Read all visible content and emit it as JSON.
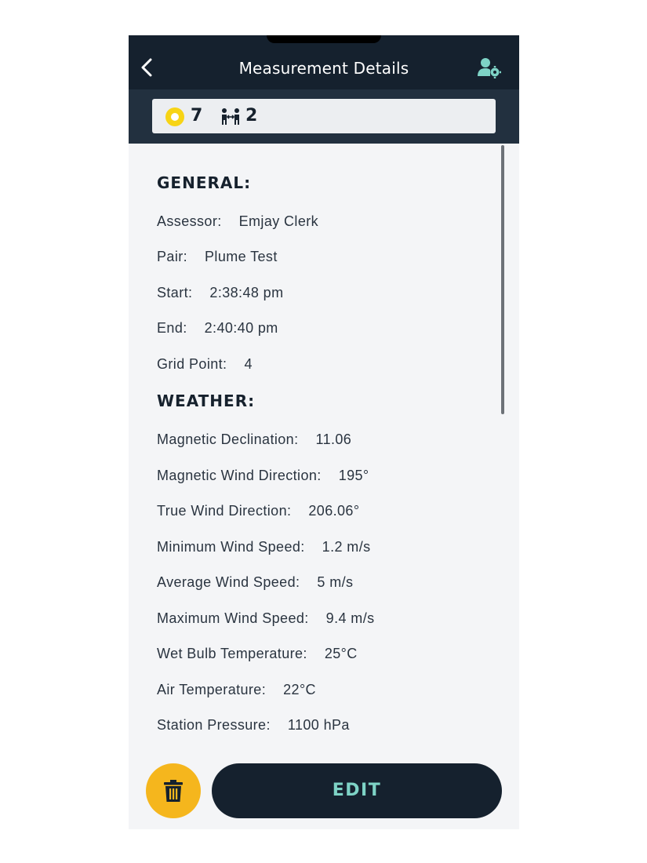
{
  "header": {
    "title": "Measurement Details",
    "back_icon": "chevron-left-icon",
    "settings_icon": "user-settings-icon"
  },
  "summary": {
    "points_icon": "yellow-ring-icon",
    "points_count": "7",
    "pairs_icon": "pair-people-icon",
    "pairs_count": "2"
  },
  "general": {
    "title": "GENERAL:",
    "rows": [
      {
        "label": "Assessor:",
        "value": "Emjay Clerk"
      },
      {
        "label": "Pair:",
        "value": "Plume Test"
      },
      {
        "label": "Start:",
        "value": "2:38:48 pm"
      },
      {
        "label": "End:",
        "value": "2:40:40 pm"
      },
      {
        "label": "Grid Point:",
        "value": "4"
      }
    ]
  },
  "weather": {
    "title": "WEATHER:",
    "rows": [
      {
        "label": "Magnetic Declination:",
        "value": "11.06"
      },
      {
        "label": "Magnetic Wind Direction:",
        "value": "195°"
      },
      {
        "label": "True Wind Direction:",
        "value": "206.06°"
      },
      {
        "label": "Minimum Wind Speed:",
        "value": "1.2 m/s"
      },
      {
        "label": "Average Wind Speed:",
        "value": "5 m/s"
      },
      {
        "label": "Maximum Wind Speed:",
        "value": "9.4 m/s"
      },
      {
        "label": "Wet Bulb Temperature:",
        "value": "25°C"
      },
      {
        "label": "Air Temperature:",
        "value": "22°C"
      },
      {
        "label": "Station Pressure:",
        "value": "1100 hPa"
      }
    ]
  },
  "actions": {
    "edit_label": "EDIT",
    "delete_icon": "trash-icon"
  },
  "colors": {
    "navbar": "#15212e",
    "subbar": "#22303f",
    "accent_yellow": "#f5b61d",
    "accent_teal": "#7ed3c6",
    "background": "#f4f5f7"
  }
}
